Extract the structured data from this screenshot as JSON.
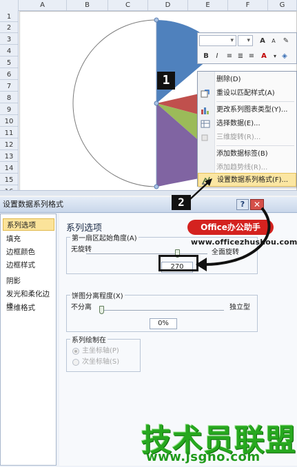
{
  "sheet": {
    "columns": [
      "A",
      "B",
      "C",
      "D",
      "E",
      "F",
      "G"
    ],
    "rows": [
      "1",
      "2",
      "3",
      "4",
      "5",
      "6",
      "7",
      "8",
      "9",
      "10",
      "11",
      "12",
      "13",
      "14",
      "15",
      "16"
    ]
  },
  "mini_toolbar": {
    "font_size": "A",
    "font_size_small": "A",
    "bold": "B",
    "italic": "I",
    "percent": "%"
  },
  "context_menu": {
    "items": [
      {
        "label": "删除(D)",
        "enabled": true,
        "icon": "delete-icon"
      },
      {
        "label": "重设以匹配样式(A)",
        "enabled": true,
        "icon": "reset-style-icon"
      },
      {
        "label": "更改系列图表类型(Y)...",
        "enabled": true,
        "icon": "chart-type-icon"
      },
      {
        "label": "选择数据(E)...",
        "enabled": true,
        "icon": "select-data-icon"
      },
      {
        "label": "三维旋转(R)...",
        "enabled": false,
        "icon": "3d-rotate-icon"
      },
      {
        "label": "添加数据标签(B)",
        "enabled": true,
        "icon": "data-label-icon"
      },
      {
        "label": "添加趋势线(R)...",
        "enabled": false,
        "icon": "trendline-icon"
      },
      {
        "label": "设置数据系列格式(F)...",
        "enabled": true,
        "highlighted": true,
        "icon": "format-series-icon"
      }
    ]
  },
  "annotations": {
    "step1": "1",
    "step2": "2",
    "banner": "Office办公助手",
    "site": "www.officezhushou.com",
    "watermark": "技术员联盟",
    "watermark_url": "www.jsgho.com"
  },
  "dialog": {
    "title": "设置数据系列格式",
    "help": "?",
    "close": "✕",
    "nav": [
      "系列选项",
      "填充",
      "边框颜色",
      "边框样式",
      "阴影",
      "发光和柔化边缘",
      "三维格式"
    ],
    "selected_nav": "系列选项",
    "panel_title": "系列选项",
    "angle": {
      "label": "第一扇区起始角度(A)",
      "min_label": "无旋转",
      "max_label": "全面旋转",
      "value": "270",
      "fraction": 0.75
    },
    "explosion": {
      "label": "饼图分离程度(X)",
      "min_label": "不分离",
      "max_label": "独立型",
      "value": "0%",
      "fraction": 0
    },
    "plot_on": {
      "label": "系列绘制在",
      "primary": "主坐标轴(P)",
      "secondary": "次坐标轴(S)",
      "selected": "primary"
    }
  },
  "colors": {
    "pie_blue": "#4f81bd",
    "pie_red": "#c0504d",
    "pie_green": "#9bbb59",
    "pie_purple": "#8064a2",
    "accent_red": "#d4221f",
    "watermark_green": "#27a81f"
  }
}
